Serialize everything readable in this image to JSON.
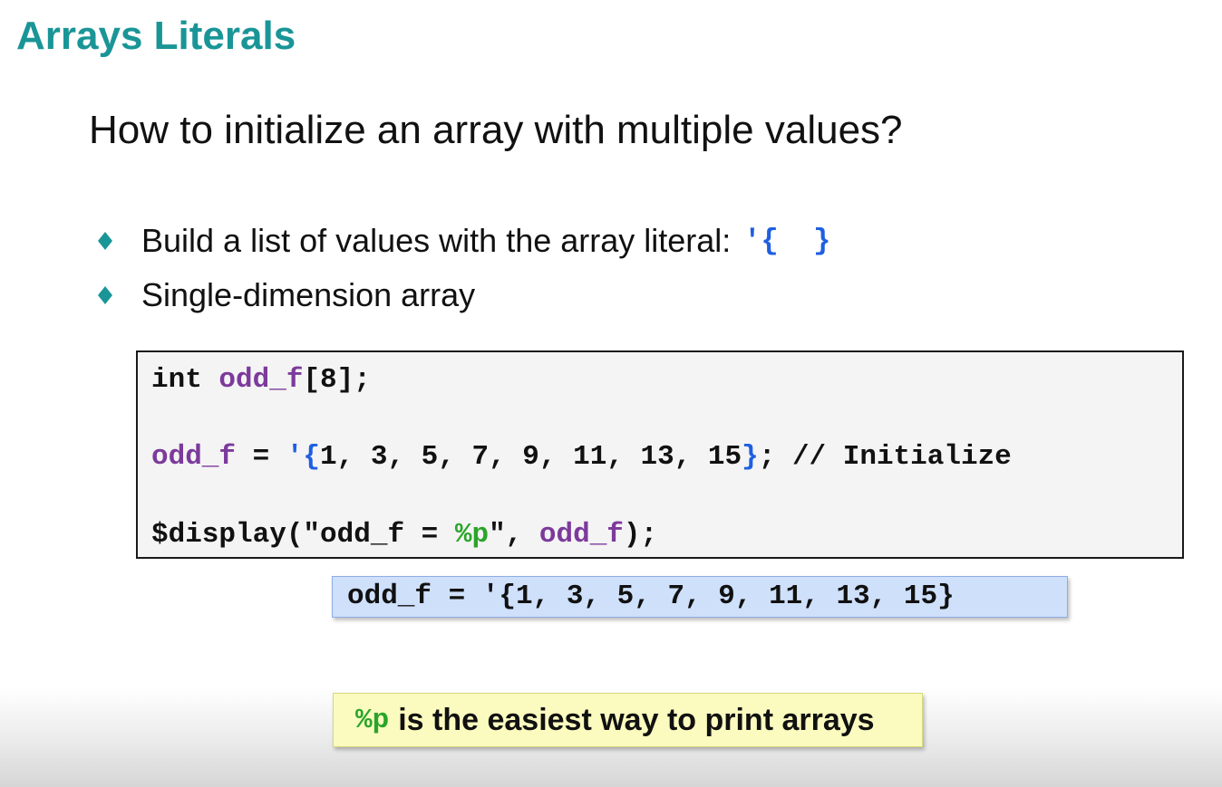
{
  "title": "Arrays Literals",
  "question": "How to initialize an array with multiple values?",
  "bullets": [
    {
      "text": "Build a list of values with the array literal:",
      "code": "'{  }"
    },
    {
      "text": "Single-dimension array"
    }
  ],
  "code": {
    "line1": {
      "kw": "int ",
      "var": "odd_f",
      "rest": "[8];"
    },
    "line2": {
      "var": "odd_f",
      "eq": " = ",
      "open": "'{",
      "values": "1, 3, 5, 7, 9, 11, 13, 15",
      "close": "}",
      "rest": "; // Initialize"
    },
    "line3": {
      "fn": "$display(\"odd_f = ",
      "fmt": "%p",
      "mid": "\", ",
      "var": "odd_f",
      "end": ");"
    }
  },
  "output": "odd_f = '{1, 3, 5, 7, 9, 11, 13, 15}",
  "note": {
    "code": "%p",
    "text": "is the easiest way to print arrays"
  },
  "colors": {
    "title": "#1a9597",
    "keyword_var": "#7c3a9c",
    "literal_brace": "#1f5fe0",
    "format_spec": "#2aa52a",
    "output_bg": "#cfe0fb",
    "note_bg": "#fbfbbf"
  },
  "icons": {
    "bullet": "diamond-icon"
  }
}
